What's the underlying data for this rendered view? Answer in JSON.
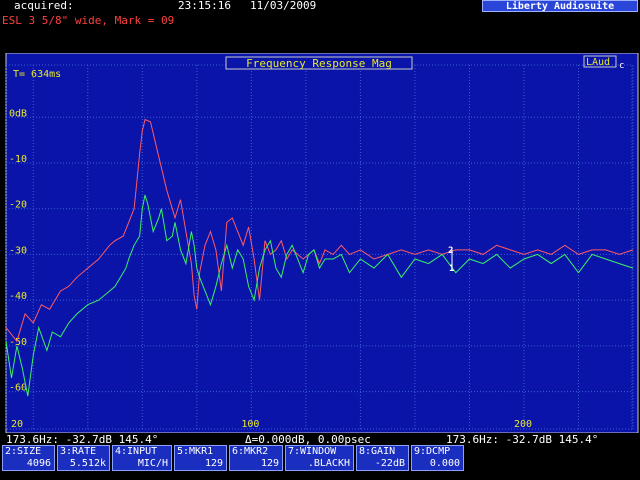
{
  "header": {
    "acquired_label": "acquired:",
    "time": "23:15:16",
    "date": "11/03/2009",
    "brand": "Liberty Audiosuite",
    "description": "ESL 3 5/8\" wide, Mark = 09"
  },
  "plot": {
    "title": "Frequency Response Mag",
    "time_label": "T= 634ms",
    "logo": "LAud",
    "logo_suffix": "c",
    "markers": [
      "2",
      "1"
    ],
    "colors": {
      "background": "#0a14a8",
      "grid": "#3c5fd6",
      "axis_text": "#e8e830",
      "red": "#ff5a64",
      "green": "#3cf064"
    }
  },
  "chart_data": {
    "type": "line",
    "title": "Frequency Response Mag",
    "xlabel": "",
    "ylabel": "",
    "xlim": [
      10,
      240
    ],
    "ylim": [
      -66,
      4
    ],
    "x_ticks": [
      20,
      100,
      200
    ],
    "y_ticks": [
      0,
      -10,
      -20,
      -30,
      -40,
      -50,
      -60
    ],
    "y_tick_labels": [
      "0dB",
      "-10",
      "-20",
      "-30",
      "-40",
      "-50",
      "-60"
    ],
    "grid": true,
    "series": [
      {
        "color": "#ff5a64",
        "x": [
          10,
          14,
          17,
          20,
          23,
          26,
          30,
          33,
          36,
          40,
          44,
          48,
          50,
          53,
          55,
          57,
          58,
          59,
          60,
          61,
          63,
          65,
          67,
          69,
          71,
          72,
          74,
          76,
          78,
          79,
          80,
          81,
          83,
          85,
          87,
          89,
          91,
          93,
          95,
          97,
          99,
          101,
          103,
          105,
          107,
          109,
          111,
          113,
          115,
          117,
          119,
          121,
          123,
          125,
          127,
          130,
          133,
          136,
          140,
          145,
          150,
          155,
          160,
          165,
          170,
          175,
          180,
          185,
          190,
          195,
          200,
          205,
          210,
          215,
          220,
          225,
          230,
          235,
          240
        ],
        "y": [
          -46,
          -49,
          -43,
          -45,
          -41,
          -42,
          -38,
          -37,
          -35,
          -33,
          -31,
          -28,
          -27,
          -26,
          -23,
          -20,
          -14,
          -8,
          -3,
          -0.5,
          -1,
          -6,
          -11,
          -16,
          -20,
          -22,
          -18,
          -25,
          -32,
          -39,
          -42,
          -34,
          -28,
          -25,
          -29,
          -38,
          -23,
          -22,
          -25,
          -28,
          -24,
          -31,
          -40,
          -27,
          -30,
          -29,
          -27,
          -31,
          -29,
          -30,
          -31,
          -30,
          -29,
          -32,
          -29,
          -30,
          -28,
          -30,
          -29,
          -31,
          -30,
          -29,
          -30,
          -29,
          -30,
          -29,
          -29,
          -30,
          -28,
          -29,
          -30,
          -29,
          -30,
          -28,
          -30,
          -29,
          -29,
          -30,
          -29
        ]
      },
      {
        "color": "#3cf064",
        "x": [
          10,
          12,
          14,
          16,
          18,
          20,
          22,
          25,
          27,
          30,
          33,
          36,
          40,
          44,
          48,
          50,
          52,
          54,
          55,
          57,
          59,
          60,
          61,
          62,
          64,
          66,
          67,
          69,
          71,
          72,
          74,
          76,
          78,
          79,
          80,
          81,
          83,
          85,
          87,
          89,
          91,
          93,
          95,
          97,
          99,
          101,
          103,
          105,
          107,
          109,
          111,
          113,
          115,
          117,
          119,
          121,
          123,
          125,
          127,
          130,
          133,
          136,
          140,
          145,
          150,
          155,
          160,
          165,
          170,
          175,
          180,
          185,
          190,
          195,
          200,
          205,
          210,
          215,
          220,
          225,
          230,
          235,
          240
        ],
        "y": [
          -49,
          -57,
          -50,
          -55,
          -61,
          -52,
          -46,
          -51,
          -47,
          -48,
          -45,
          -43,
          -41,
          -40,
          -38,
          -37,
          -35,
          -33,
          -31,
          -28,
          -26,
          -20,
          -17,
          -19,
          -25,
          -22,
          -20,
          -27,
          -26,
          -23,
          -29,
          -32,
          -25,
          -28,
          -33,
          -35,
          -38,
          -41,
          -37,
          -32,
          -28,
          -33,
          -29,
          -31,
          -37,
          -40,
          -33,
          -29,
          -27,
          -33,
          -35,
          -30,
          -28,
          -31,
          -34,
          -30,
          -29,
          -33,
          -31,
          -31,
          -30,
          -34,
          -31,
          -33,
          -30,
          -35,
          -31,
          -32,
          -30,
          -34,
          -31,
          -32,
          -30,
          -33,
          -31,
          -30,
          -32,
          -30,
          -34,
          -30,
          -31,
          -32,
          -33
        ]
      }
    ]
  },
  "status": {
    "left": "173.6Hz: -32.7dB 145.4°",
    "center": "Δ=0.000dB, 0.00psec",
    "right": "173.6Hz: -32.7dB 145.4°"
  },
  "function_keys": [
    {
      "label": "2:SIZE",
      "value": "4096"
    },
    {
      "label": "3:RATE",
      "value": "5.512k"
    },
    {
      "label": "4:INPUT",
      "value": "MIC/H"
    },
    {
      "label": "5:MKR1",
      "value": "129"
    },
    {
      "label": "6:MKR2",
      "value": "129"
    },
    {
      "label": "7:WINDOW",
      "value": ".BLACKH"
    },
    {
      "label": "8:GAIN",
      "value": "-22dB"
    },
    {
      "label": "9:DCMP",
      "value": "0.000"
    }
  ]
}
